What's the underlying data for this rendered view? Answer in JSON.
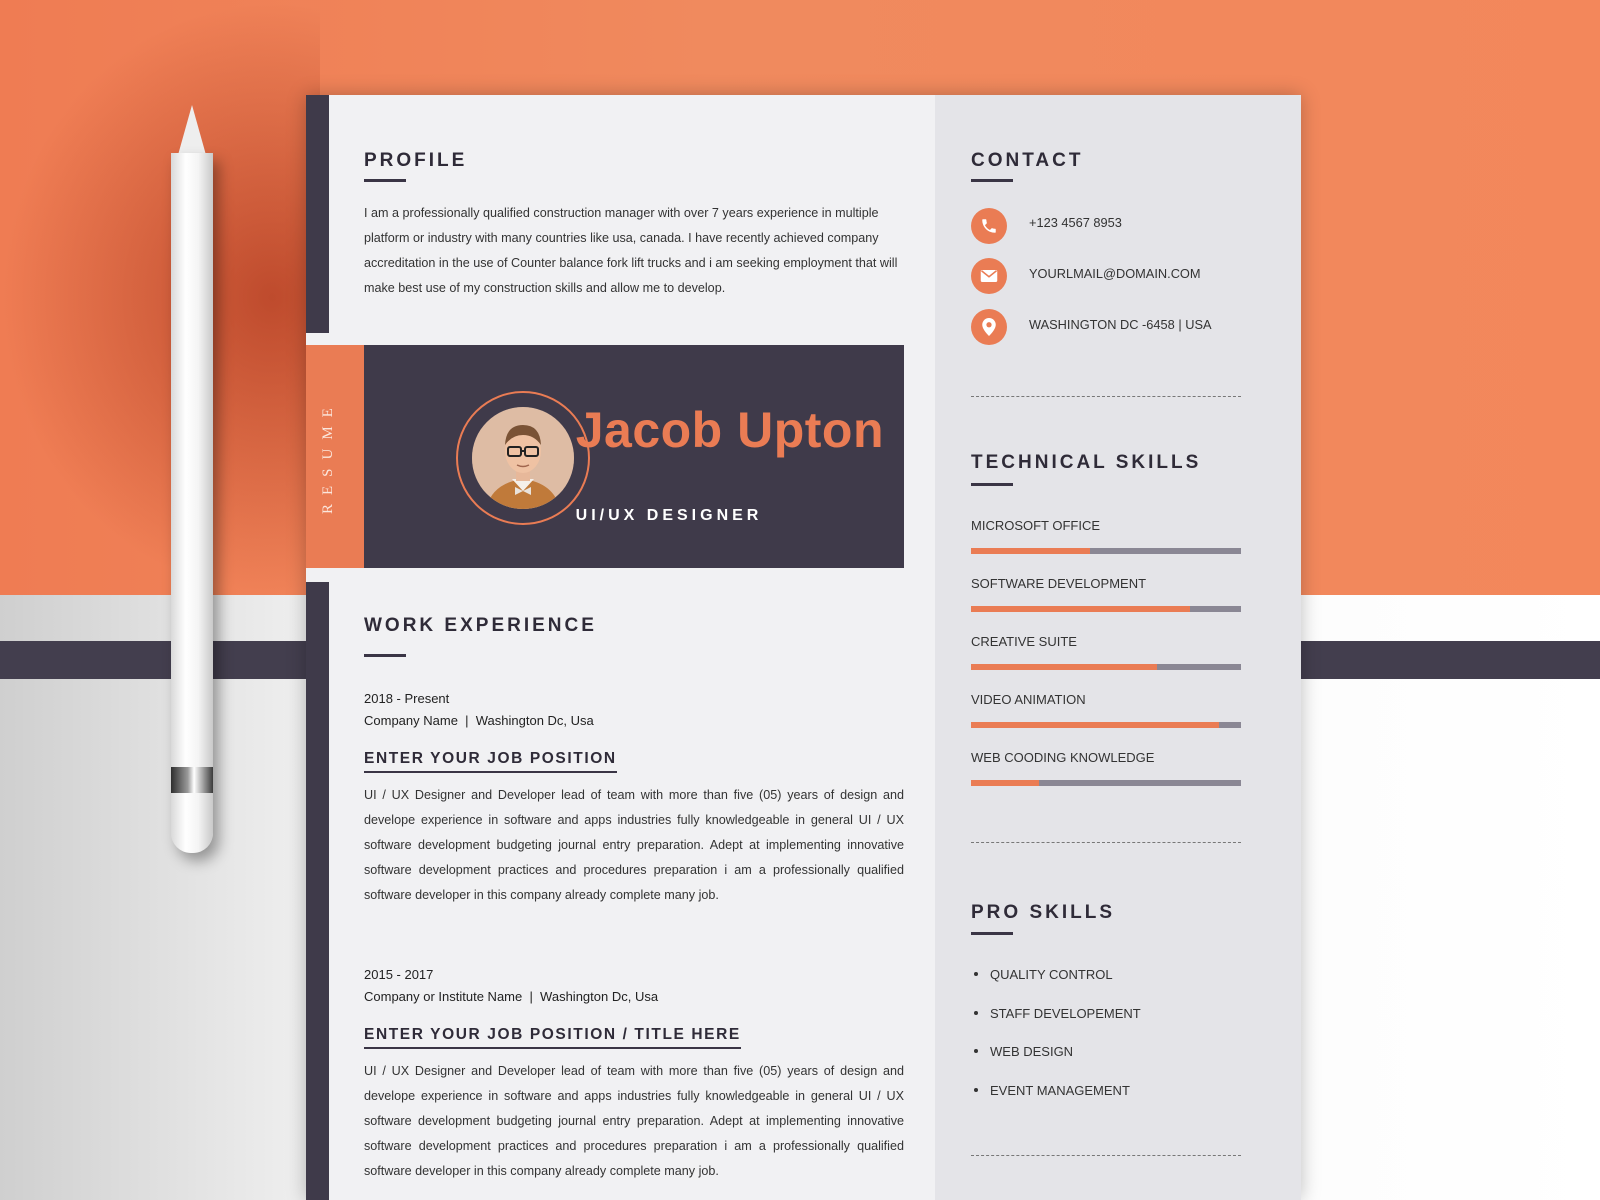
{
  "profile": {
    "title": "PROFILE",
    "text": "I am a professionally qualified construction manager with over 7 years experience in multiple platform or industry with many countries like usa, canada. I have recently achieved company accreditation in the use of Counter balance fork lift trucks and i am seeking employment that will make best use of my construction skills and allow me to develop."
  },
  "banner": {
    "side_label": "RESUME",
    "name": "Jacob Upton",
    "role": "UI/UX DESIGNER"
  },
  "work": {
    "title": "WORK EXPERIENCE",
    "jobs": [
      {
        "date": "2018 - Present",
        "company": "Company Name  |  Washington Dc, Usa",
        "position": "ENTER YOUR JOB POSITION",
        "description": "UI / UX Designer and Developer lead of team with more than five (05) years of design and develope experience in software and apps industries fully knowledgeable in general UI / UX software development budgeting journal entry preparation. Adept at implementing innovative software development practices and procedures preparation i am a professionally qualified software developer in this company already complete many job."
      },
      {
        "date": "2015 - 2017",
        "company": "Company or Institute Name  |  Washington Dc, Usa",
        "position": "ENTER YOUR JOB POSITION / TITLE HERE",
        "description": "UI / UX Designer and Developer lead of team with more than five (05) years of design and develope experience in software and apps industries fully knowledgeable in general UI / UX software development budgeting journal entry preparation. Adept at implementing innovative software development practices and procedures preparation i am a professionally qualified software developer in this company already complete many job."
      }
    ]
  },
  "contact": {
    "title": "CONTACT",
    "items": [
      {
        "icon": "phone-icon",
        "text": "+123 4567 8953"
      },
      {
        "icon": "mail-icon",
        "text": "YOURLMAIL@DOMAIN.COM"
      },
      {
        "icon": "location-pin-icon",
        "text": "WASHINGTON DC -6458 | USA"
      }
    ]
  },
  "technical_skills": {
    "title": "TECHNICAL SKILLS",
    "items": [
      {
        "label": "MICROSOFT OFFICE",
        "level": 0.44
      },
      {
        "label": "SOFTWARE DEVELOPMENT",
        "level": 0.81
      },
      {
        "label": "CREATIVE SUITE",
        "level": 0.69
      },
      {
        "label": "VIDEO ANIMATION",
        "level": 0.92
      },
      {
        "label": "WEB COODING KNOWLEDGE",
        "level": 0.25
      }
    ]
  },
  "pro_skills": {
    "title": "PRO SKILLS",
    "items": [
      "QUALITY CONTROL",
      "STAFF DEVELOPEMENT",
      "WEB DESIGN",
      "EVENT MANAGEMENT"
    ]
  },
  "colors": {
    "accent": "#ea7c54",
    "dark": "#3f3a4a",
    "sidebar_bg": "#e4e4e8",
    "skill_track": "#8a8794"
  }
}
